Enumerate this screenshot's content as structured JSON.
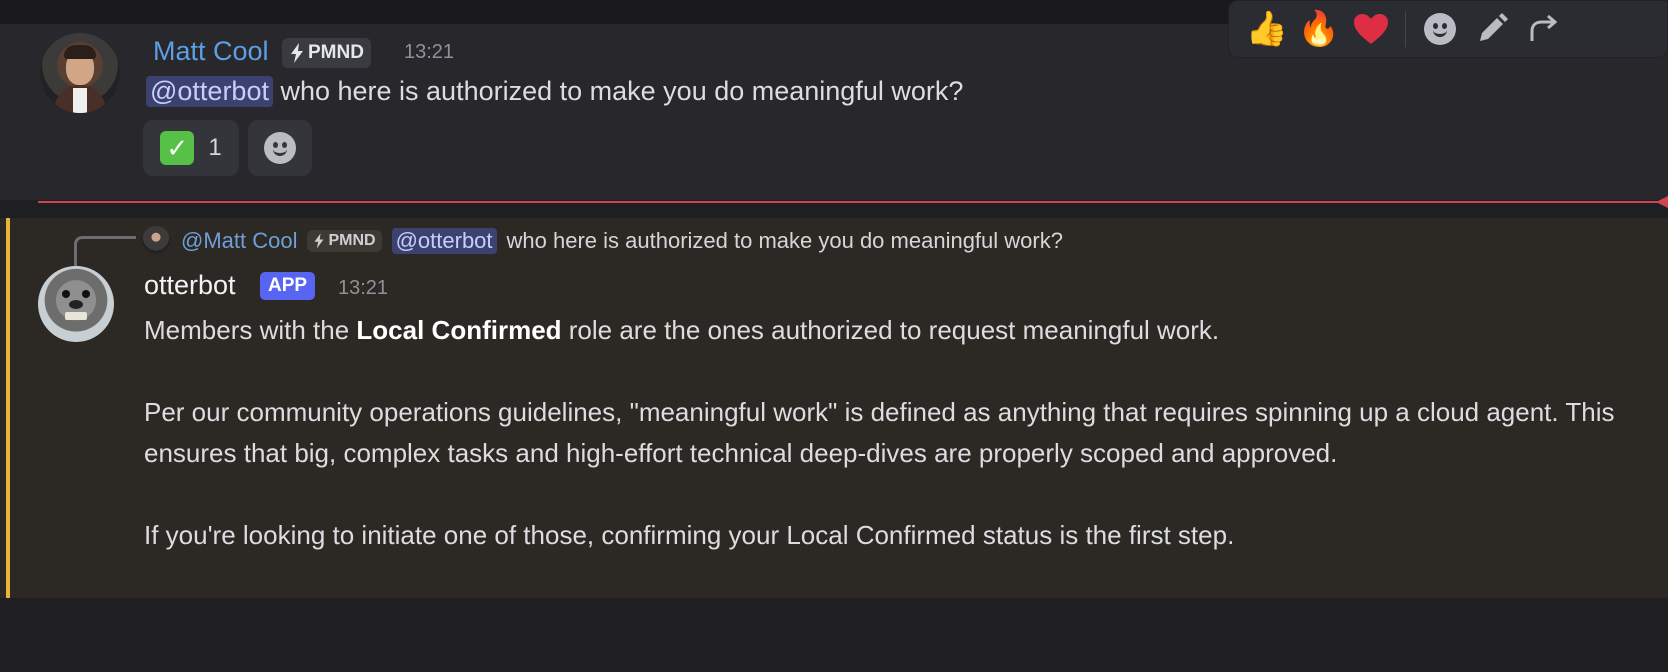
{
  "message1": {
    "author": "Matt Cool",
    "tag": "PMND",
    "tag_icon": "lightning-icon",
    "time": "13:21",
    "mention": "@otterbot",
    "text": " who here is authorized to make you do meaningful work?",
    "reactions": [
      {
        "emoji": "check-mark-icon",
        "count": "1"
      }
    ],
    "add_reaction_icon": "smiley-icon"
  },
  "toolbar": {
    "items": [
      "thumbs-up-icon",
      "fire-icon",
      "heart-icon",
      "smiley-icon",
      "pencil-icon",
      "forward-icon"
    ]
  },
  "message2": {
    "reply": {
      "author": "@Matt Cool",
      "tag": "PMND",
      "mention": "@otterbot",
      "text": "who here is authorized to make you do meaningful work?"
    },
    "author": "otterbot",
    "app_tag": "APP",
    "time": "13:21",
    "para1_pre": "Members with the ",
    "para1_bold": "Local Confirmed",
    "para1_post": " role are the ones authorized to request meaningful work.",
    "para2": "Per our community operations guidelines, \"meaningful work\" is defined as anything that requires spinning up a cloud agent. This ensures that big, complex tasks and high-effort technical deep-dives are properly scoped and approved.",
    "para3": "If you're looking to initiate one of those, confirming your Local Confirmed status is the first step."
  },
  "colors": {
    "mention_bg": "#3c4270",
    "author1": "#5e9fe4",
    "app_badge": "#5865f2",
    "highlight_bar": "#e9b33e",
    "new_divider": "#d0454d"
  }
}
